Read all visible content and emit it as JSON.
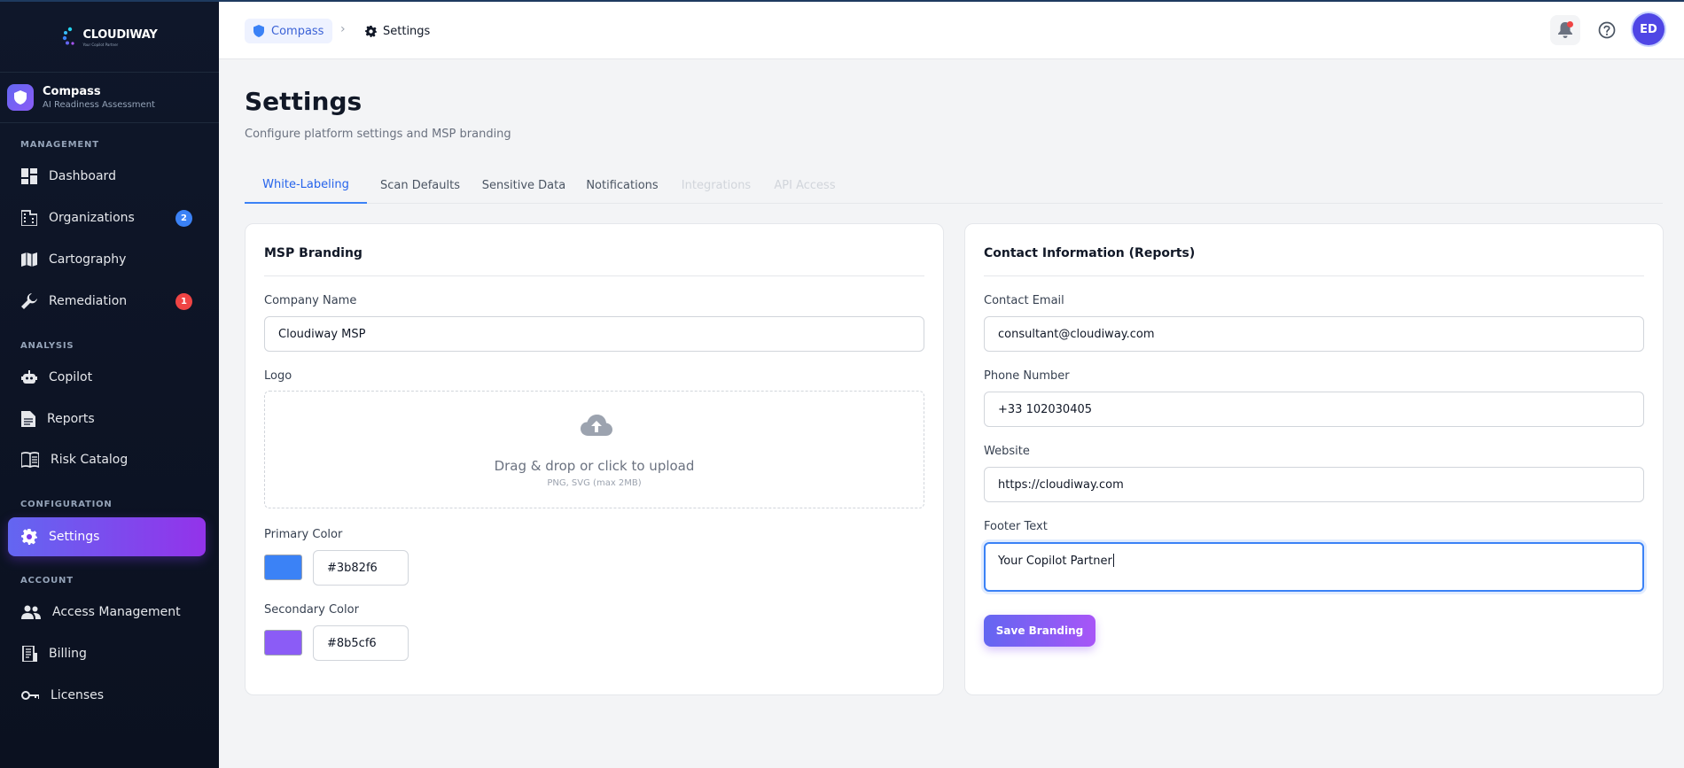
{
  "brand": {
    "logo_text": "CLOUDIWAY",
    "logo_tagline": "Your Copilot Partner"
  },
  "product": {
    "name": "Compass",
    "subtitle": "AI Readiness Assessment"
  },
  "sidebar": {
    "sections": [
      "MANAGEMENT",
      "ANALYSIS",
      "CONFIGURATION",
      "ACCOUNT"
    ],
    "items": [
      {
        "label": "Dashboard",
        "icon": "dashboard-icon"
      },
      {
        "label": "Organizations",
        "icon": "building-icon",
        "badge": "2"
      },
      {
        "label": "Cartography",
        "icon": "map-icon"
      },
      {
        "label": "Remediation",
        "icon": "wrench-icon",
        "badge": "1"
      },
      {
        "label": "Copilot",
        "icon": "robot-icon"
      },
      {
        "label": "Reports",
        "icon": "document-icon"
      },
      {
        "label": "Risk Catalog",
        "icon": "book-icon"
      },
      {
        "label": "Settings",
        "icon": "gear-icon",
        "active": true
      },
      {
        "label": "Access Management",
        "icon": "users-icon"
      },
      {
        "label": "Billing",
        "icon": "receipt-icon"
      },
      {
        "label": "Licenses",
        "icon": "key-icon"
      }
    ]
  },
  "header": {
    "breadcrumb": {
      "home": "Compass",
      "current": "Settings"
    },
    "avatar_initials": "ED"
  },
  "page": {
    "title": "Settings",
    "subtitle": "Configure platform settings and MSP branding"
  },
  "tabs": [
    {
      "label": "White-Labeling",
      "state": "active"
    },
    {
      "label": "Scan Defaults",
      "state": "normal"
    },
    {
      "label": "Sensitive Data",
      "state": "normal"
    },
    {
      "label": "Notifications",
      "state": "normal"
    },
    {
      "label": "Integrations",
      "state": "disabled"
    },
    {
      "label": "API Access",
      "state": "disabled"
    }
  ],
  "branding": {
    "title": "MSP Branding",
    "company_name_label": "Company Name",
    "company_name_value": "Cloudiway MSP",
    "logo_label": "Logo",
    "upload_text": "Drag & drop or click to upload",
    "upload_hint": "PNG, SVG (max 2MB)",
    "primary_color_label": "Primary Color",
    "primary_color_value": "#3b82f6",
    "secondary_color_label": "Secondary Color",
    "secondary_color_value": "#8b5cf6"
  },
  "contact": {
    "title": "Contact Information (Reports)",
    "email_label": "Contact Email",
    "email_value": "consultant@cloudiway.com",
    "phone_label": "Phone Number",
    "phone_value": "+33 102030405",
    "website_label": "Website",
    "website_value": "https://cloudiway.com",
    "footer_label": "Footer Text",
    "footer_value": "Your Copilot Partner",
    "save_label": "Save Branding"
  },
  "colors": {
    "accent": "#3b82f6",
    "brand_gradient_start": "#6366f1",
    "brand_gradient_end": "#9333ea",
    "sidebar_bg": "#0f172a"
  }
}
